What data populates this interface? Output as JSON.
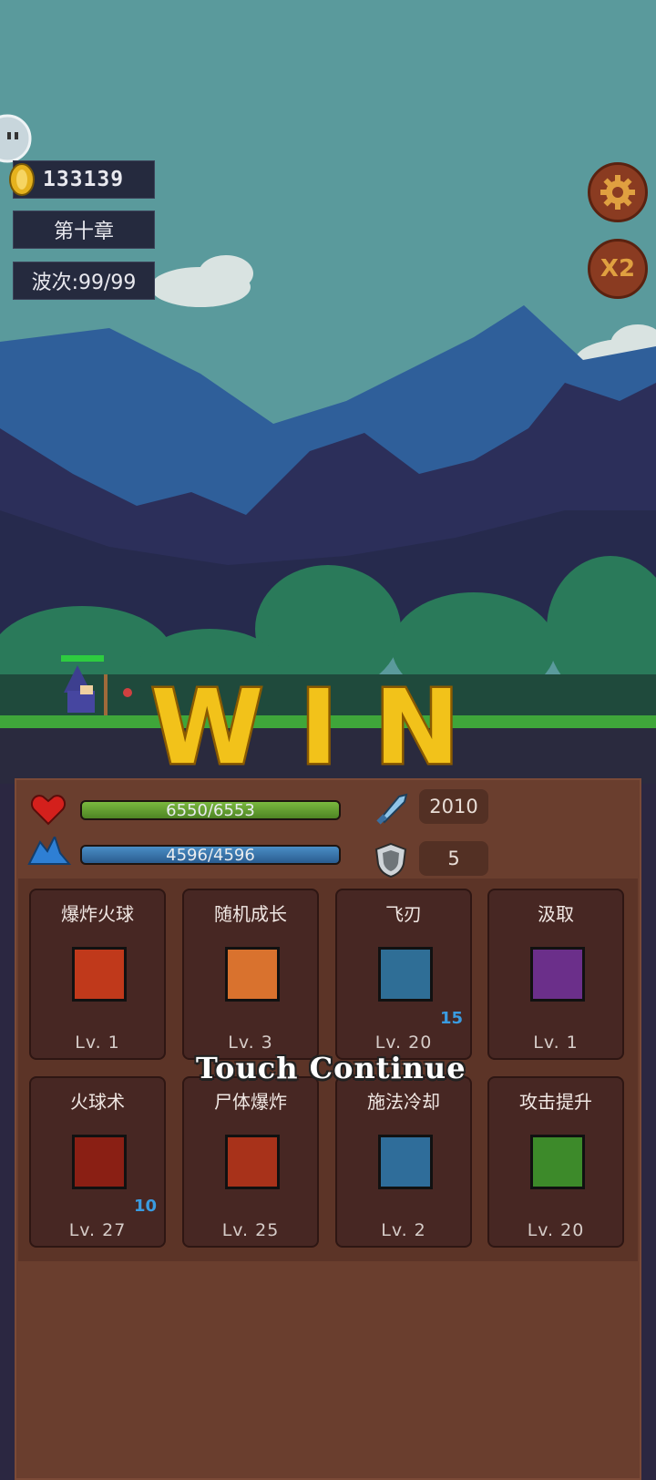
{
  "hud": {
    "coins": "133139",
    "chapter": "第十章",
    "wave": "波次:99/99",
    "speed_label": "X2"
  },
  "banner": {
    "win_text": "WIN",
    "touch_continue": "Touch Continue"
  },
  "stats": {
    "hp": "6550/6553",
    "hp_fraction": 0.9995,
    "mp": "4596/4596",
    "mp_fraction": 1.0,
    "attack": "2010",
    "defense": "5"
  },
  "skills": [
    {
      "name": "爆炸火球",
      "level": "Lv. 1",
      "count": "",
      "icon": "explosion-fireball-icon",
      "color": "#c0391b"
    },
    {
      "name": "随机成长",
      "level": "Lv. 3",
      "count": "",
      "icon": "fist-icon",
      "color": "#d9722e"
    },
    {
      "name": "飞刃",
      "level": "Lv. 20",
      "count": "15",
      "icon": "flying-blade-icon",
      "color": "#2f6e96"
    },
    {
      "name": "汲取",
      "level": "Lv. 1",
      "count": "",
      "icon": "swirl-icon",
      "color": "#6b2f8a"
    },
    {
      "name": "火球术",
      "level": "Lv. 27",
      "count": "10",
      "icon": "fireball-icon",
      "color": "#8a1f14"
    },
    {
      "name": "尸体爆炸",
      "level": "Lv. 25",
      "count": "",
      "icon": "corpse-explosion-icon",
      "color": "#a8321a"
    },
    {
      "name": "施法冷却",
      "level": "Lv. 2",
      "count": "",
      "icon": "lightning-icon",
      "color": "#2f6d9a"
    },
    {
      "name": "攻击提升",
      "level": "Lv. 20",
      "count": "",
      "icon": "arrow-up-icon",
      "color": "#3d8a2a"
    }
  ]
}
